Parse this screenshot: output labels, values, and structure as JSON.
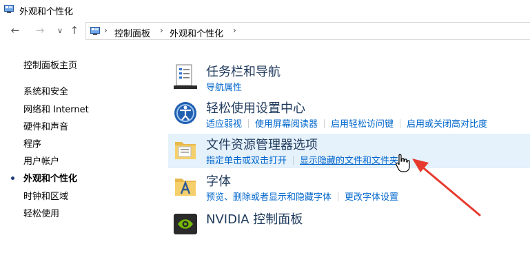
{
  "window": {
    "title": "外观和个性化"
  },
  "nav": {
    "back_glyph": "←",
    "forward_glyph": "→",
    "dropdown_glyph": "∨",
    "up_glyph": "↑"
  },
  "address": {
    "separator": "›",
    "crumbs": [
      "控制面板",
      "外观和个性化"
    ]
  },
  "sidebar": {
    "items": [
      {
        "label": "控制面板主页",
        "current": false
      },
      {
        "label": "系统和安全",
        "current": false
      },
      {
        "label": "网络和 Internet",
        "current": false
      },
      {
        "label": "硬件和声音",
        "current": false
      },
      {
        "label": "程序",
        "current": false
      },
      {
        "label": "用户帐户",
        "current": false
      },
      {
        "label": "外观和个性化",
        "current": true
      },
      {
        "label": "时钟和区域",
        "current": false
      },
      {
        "label": "轻松使用",
        "current": false
      }
    ]
  },
  "categories": [
    {
      "title": "任务栏和导航",
      "icon": "taskbar-icon",
      "links": [
        "导航属性"
      ]
    },
    {
      "title": "轻松使用设置中心",
      "icon": "ease-of-access-icon",
      "links": [
        "适应弱视",
        "使用屏幕阅读器",
        "启用轻松访问键",
        "启用或关闭高对比度"
      ]
    },
    {
      "title": "文件资源管理器选项",
      "icon": "folder-options-icon",
      "links": [
        "指定单击或双击打开",
        "显示隐藏的文件和文件夹"
      ],
      "highlighted": true
    },
    {
      "title": "字体",
      "icon": "fonts-folder-icon",
      "links": [
        "预览、删除或者显示和隐藏字体",
        "更改字体设置"
      ]
    },
    {
      "title": "NVIDIA 控制面板",
      "icon": "nvidia-icon",
      "links": []
    }
  ],
  "colors": {
    "link": "#0066cc",
    "title": "#1e395b",
    "highlight": "#e5f1fb",
    "arrow": "#e63a2e"
  }
}
